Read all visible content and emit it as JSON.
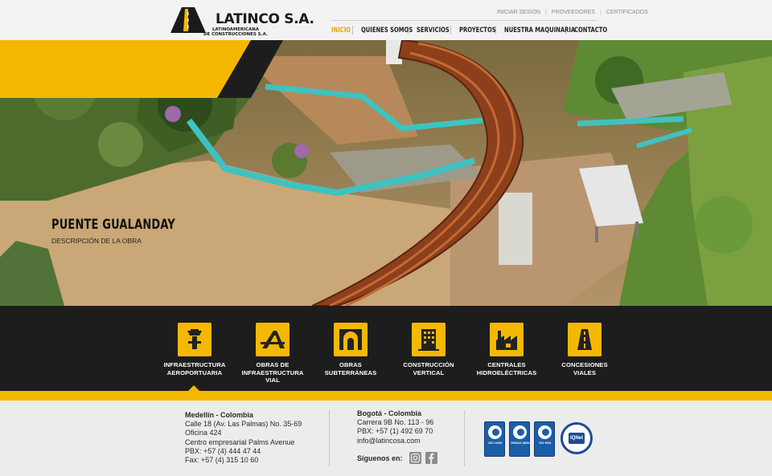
{
  "brand": {
    "name": "LATINCO S.A.",
    "subtitle_line1": "LATINOAMERICANA",
    "subtitle_line2": "DE CONSTRUCCIONES S.A.",
    "colors": {
      "accent": "#f4b800",
      "dark": "#1d1d1d",
      "header_bg": "#f3f3f3"
    }
  },
  "top_links": [
    "INICIAR SESIÓN",
    "PROVEEDORES",
    "CERTIFICADOS"
  ],
  "nav": {
    "items": [
      {
        "label": "INICIO",
        "active": true
      },
      {
        "label": "QUIENES SOMOS",
        "active": false
      },
      {
        "label": "SERVICIOS",
        "active": false
      },
      {
        "label": "PROYECTOS",
        "active": false
      },
      {
        "label": "NUESTRA MAQUINARIA",
        "active": false
      },
      {
        "label": "CONTACTO",
        "active": false
      }
    ]
  },
  "hero": {
    "title": "PUENTE GUALANDAY",
    "description": "DESCRIPCIÓN DE LA OBRA"
  },
  "services": [
    {
      "label_line1": "INFRAESTRUCTURA",
      "label_line2": "AEROPORTUARIA",
      "label_line3": "",
      "icon": "airport-tower-icon",
      "selected": true
    },
    {
      "label_line1": "OBRAS DE",
      "label_line2": "INFRAESTRUCTURA",
      "label_line3": "VIAL",
      "icon": "road-bridge-icon",
      "selected": false
    },
    {
      "label_line1": "OBRAS",
      "label_line2": "SUBTERRÁNEAS",
      "label_line3": "",
      "icon": "tunnel-icon",
      "selected": false
    },
    {
      "label_line1": "CONSTRUCCIÓN",
      "label_line2": "VERTICAL",
      "label_line3": "",
      "icon": "building-icon",
      "selected": false
    },
    {
      "label_line1": "CENTRALES",
      "label_line2": "HIDROELÉCTRICAS",
      "label_line3": "",
      "icon": "power-plant-icon",
      "selected": false
    },
    {
      "label_line1": "CONCESIONES",
      "label_line2": "VIALES",
      "label_line3": "",
      "icon": "highway-icon",
      "selected": false
    }
  ],
  "footer": {
    "medellin": {
      "city": "Medellín - Colombia",
      "line1": "Calle 18 (Av. Las Palmas) No. 35-69",
      "line2": "Oficina 424",
      "line3": "Centro empresarial Palms Avenue",
      "line4": "PBX: +57 (4) 444 47 44",
      "line5": "Fax: +57 (4) 315 10 60"
    },
    "bogota": {
      "city": "Bogotá - Colombia",
      "line1": "Carrera 9B No. 113 - 96",
      "line2": "PBX: +57 (1) 492 69 70",
      "line3": "info@latincosa.com"
    },
    "social_label": "Síguenos en:",
    "social_icons": [
      "instagram-icon",
      "facebook-icon"
    ],
    "certifications": [
      {
        "code": "ISO 14001"
      },
      {
        "code": "OHSAS 18001"
      },
      {
        "code": "ISO 9001"
      }
    ],
    "iqnet_label": "IQNet"
  }
}
